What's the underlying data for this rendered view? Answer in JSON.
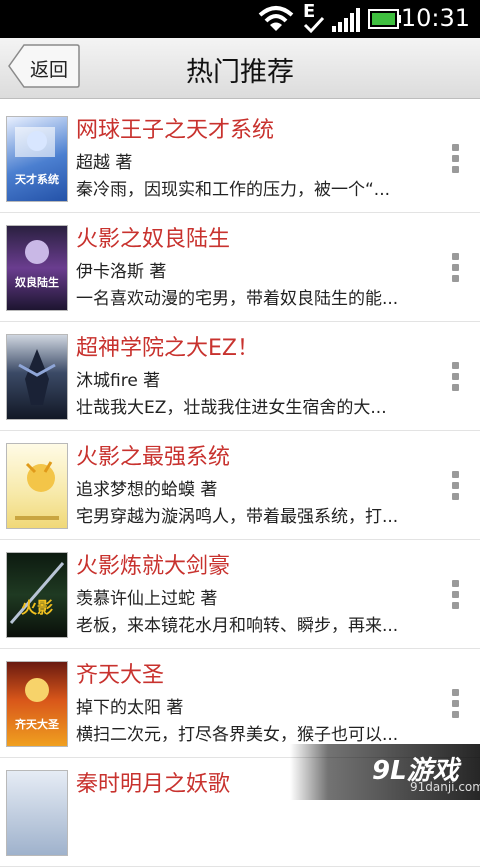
{
  "status_bar": {
    "network_type": "E",
    "time": "10:31",
    "icons": [
      "wifi-icon",
      "signal-icon",
      "battery-icon"
    ]
  },
  "header": {
    "back_label": "返回",
    "title": "热门推荐"
  },
  "books": [
    {
      "title": "网球王子之天才系统",
      "author": "超越 著",
      "description": "秦冷雨，因现实和工作的压力，被一个“...",
      "cover_text": "天才系统"
    },
    {
      "title": "火影之奴良陆生",
      "author": "伊卡洛斯 著",
      "description": "一名喜欢动漫的宅男，带着奴良陆生的能...",
      "cover_text": "奴良陆生"
    },
    {
      "title": "超神学院之大EZ！",
      "author": "沐城fire 著",
      "description": "壮哉我大EZ，壮哉我住进女生宿舍的大...",
      "cover_text": ""
    },
    {
      "title": "火影之最强系统",
      "author": "追求梦想的蛤蟆 著",
      "description": "宅男穿越为漩涡鸣人，带着最强系统，打...",
      "cover_text": ""
    },
    {
      "title": "火影炼就大剑豪",
      "author": "羡慕许仙上过蛇 著",
      "description": "老板，来本镜花水月和响转、瞬步，再来...",
      "cover_text": "火影"
    },
    {
      "title": "齐天大圣",
      "author": "掉下的太阳 著",
      "description": "横扫二次元，打尽各界美女，猴子也可以...",
      "cover_text": "齐天大圣"
    },
    {
      "title": "秦时明月之妖歌",
      "author": "",
      "description": "",
      "cover_text": ""
    }
  ],
  "watermark": {
    "logo": "9L游戏",
    "url": "91danji.com"
  },
  "colors": {
    "title_red": "#c8322e",
    "status_bar_bg": "#000000"
  }
}
